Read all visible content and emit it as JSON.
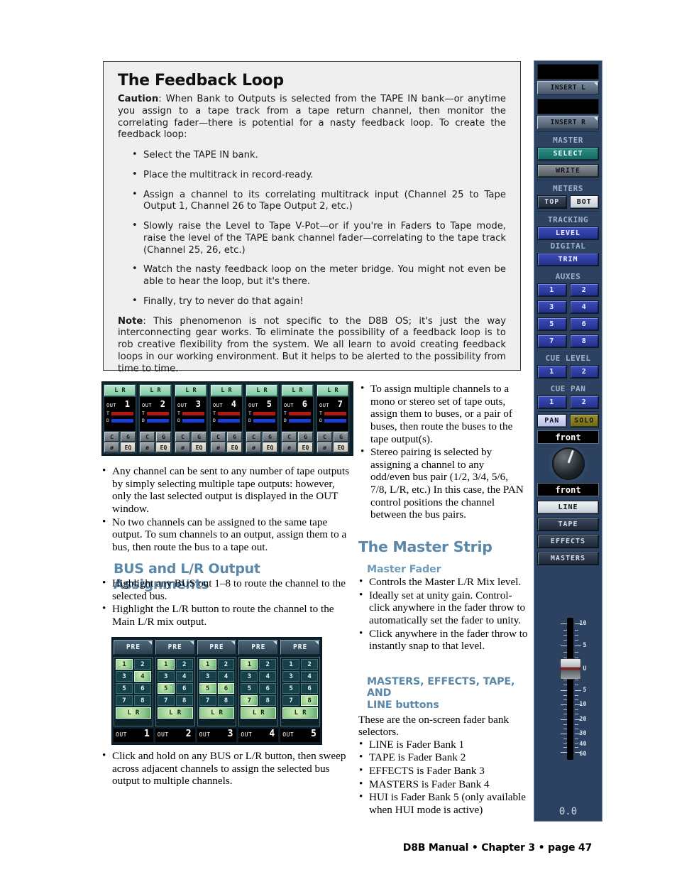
{
  "callout": {
    "title": "The Feedback Loop",
    "caution_label": "Caution",
    "caution_text": ": When Bank to Outputs is selected from the TAPE IN bank—or anytime you assign to a tape track from a tape return channel, then monitor the correlating fader—there is potential for a nasty feedback loop. To create the feedback loop:",
    "steps": [
      "Select the TAPE IN bank.",
      "Place the multitrack in record-ready.",
      "Assign a channel to its correlating multitrack input (Channel 25 to Tape Output 1, Channel 26 to Tape Output 2, etc.)",
      "Slowly raise the Level to Tape V-Pot—or if you're in Faders to Tape mode, raise the level of the TAPE bank channel fader—correlating to the tape track (Channel 25, 26, etc.)",
      "Watch the nasty feedback loop on the meter bridge. You might not even be able to hear the loop, but it's there.",
      "Finally, try to never do that again!"
    ],
    "note_label": "Note",
    "note_text": ": This phenomenon is not specific to the D8B OS; it's just the way interconnecting gear works. To eliminate the possibility of a feedback loop is to rob creative flexibility from the system. We all learn to avoid creating feedback loops in our working environment. But it helps to be alerted to the possibility from time to time."
  },
  "fig_out_strips": {
    "lr_left": "L",
    "lr_right": "R",
    "out_word": "OUT",
    "meter_t": "T",
    "meter_d": "D",
    "btn_c": "C",
    "btn_g": "G",
    "btn_phase": "ø",
    "btn_eq": "EQ",
    "channels": [
      {
        "number": "1"
      },
      {
        "number": "2"
      },
      {
        "number": "3"
      },
      {
        "number": "4"
      },
      {
        "number": "5"
      },
      {
        "number": "6"
      },
      {
        "number": "7"
      }
    ]
  },
  "left_col": {
    "bullets_1": [
      "Any channel can be sent to any number of tape outputs by simply selecting multiple tape outputs: however, only the last selected output is displayed in the OUT window.",
      "No two channels can be assigned to the same tape output. To sum channels to an output, assign them to a bus, then route the bus to a tape out."
    ],
    "heading_bus": "BUS and L/R Output Assignments",
    "bullets_2": [
      "Highlight any BUS out 1–8 to route the channel to the selected bus.",
      "Highlight the L/R button to route the channel to the Main L/R mix output."
    ],
    "bullets_3": [
      "Click and hold on any BUS or L/R button, then sweep across adjacent channels to assign  the selected bus output to multiple channels."
    ]
  },
  "fig_bus": {
    "pre_label": "PRE",
    "out_word": "OUT",
    "lr_left": "L",
    "lr_right": "R",
    "bus_numbers": [
      "1",
      "2",
      "3",
      "4",
      "5",
      "6",
      "7",
      "8"
    ],
    "strips": [
      {
        "out": "1",
        "active": [
          "1",
          "4"
        ],
        "lr_on": true
      },
      {
        "out": "2",
        "active": [
          "1",
          "5"
        ],
        "lr_on": true
      },
      {
        "out": "3",
        "active": [
          "1",
          "5",
          "6"
        ],
        "lr_on": true
      },
      {
        "out": "4",
        "active": [
          "1",
          "7"
        ],
        "lr_on": true
      },
      {
        "out": "5",
        "active": [
          "8"
        ],
        "lr_on": true
      }
    ]
  },
  "right_col": {
    "bullets_1": [
      "To assign multiple channels to a mono or stereo set of tape outs, assign them to buses, or a pair of buses, then route the buses to the tape output(s).",
      "Stereo pairing is selected by assigning a channel to any odd/even bus pair (1/2, 3/4, 5/6, 7/8, L/R, etc.) In this case, the PAN control positions the channel between the bus pairs."
    ],
    "heading_master_strip": "The Master Strip",
    "heading_master_fader": "Master Fader",
    "bullets_2": [
      "Controls the Master L/R Mix level.",
      "Ideally set at unity gain. Control-click anywhere in the fader throw to automatically set the fader to unity.",
      "Click anywhere in the fader throw to instantly snap to that level."
    ],
    "heading_buttons_line1": "MASTERS, EFFECTS, TAPE, AND",
    "heading_buttons_line2": "LINE buttons",
    "intro": "These are the on-screen fader bank selectors.",
    "bullets_3": [
      "LINE is Fader Bank 1",
      "TAPE is Fader Bank 2",
      "EFFECTS is Fader Bank 3",
      "MASTERS is Fader Bank 4",
      "HUI is Fader Bank 5 (only available when HUI mode is active)"
    ]
  },
  "master_strip": {
    "insert_l": "INSERT L",
    "insert_r": "INSERT R",
    "master_label": "MASTER",
    "select": "SELECT",
    "write": "WRITE",
    "meters_label": "METERS",
    "meters_top": "TOP",
    "meters_bot": "BOT",
    "tracking_label": "TRACKING",
    "level": "LEVEL",
    "digital_label": "DIGITAL",
    "trim": "TRIM",
    "auxes_label": "AUXES",
    "auxes": [
      "1",
      "2",
      "3",
      "4",
      "5",
      "6",
      "7",
      "8"
    ],
    "cue_level_label": "CUE LEVEL",
    "cue_level": [
      "1",
      "2"
    ],
    "cue_pan_label": "CUE PAN",
    "cue_pan": [
      "1",
      "2"
    ],
    "pan": "PAN",
    "solo": "SOLO",
    "display_top": "front",
    "display_bottom": "front",
    "bank_line": "LINE",
    "bank_tape": "TAPE",
    "bank_effects": "EFFECTS",
    "bank_masters": "MASTERS",
    "fader_scale": [
      "10",
      "5",
      "U",
      "5",
      "10",
      "20",
      "30",
      "40",
      "60"
    ],
    "fader_value": "0.0"
  },
  "footer": "D8B Manual • Chapter 3 • page  47",
  "colors": {
    "panel_bg": "#2d4260",
    "accent_heading": "#5b87a8",
    "sub_heading": "#6f9ab8",
    "callout_bg": "#efefef",
    "bus_on": "#86c78a",
    "meter_t": "#b01818",
    "meter_d": "#1a3fd8"
  }
}
